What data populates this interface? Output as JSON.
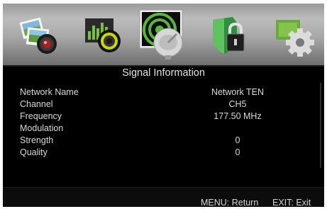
{
  "menu_icons": [
    {
      "name": "picture",
      "icon": "photo-camera-icon",
      "selected": false
    },
    {
      "name": "audio",
      "icon": "equalizer-speaker-icon",
      "selected": false
    },
    {
      "name": "channel",
      "icon": "satellite-dish-radar-icon",
      "selected": true
    },
    {
      "name": "lock",
      "icon": "shield-padlock-icon",
      "selected": false
    },
    {
      "name": "setup",
      "icon": "gear-icon",
      "selected": false
    }
  ],
  "panel": {
    "title": "Signal Information",
    "rows": [
      {
        "label": "Network Name",
        "value": "Network TEN"
      },
      {
        "label": "Channel",
        "value": "CH5"
      },
      {
        "label": "Frequency",
        "value": "177.50 MHz"
      },
      {
        "label": "Modulation",
        "value": ""
      },
      {
        "label": "Strength",
        "value": "0"
      },
      {
        "label": "Quality",
        "value": "0"
      }
    ]
  },
  "footer": {
    "menu_hint": "MENU: Return",
    "exit_hint": "EXIT: Exit"
  },
  "colors": {
    "background": "#000000",
    "text": "#d8d8d8",
    "icon_bar": "#a7a7a7"
  }
}
